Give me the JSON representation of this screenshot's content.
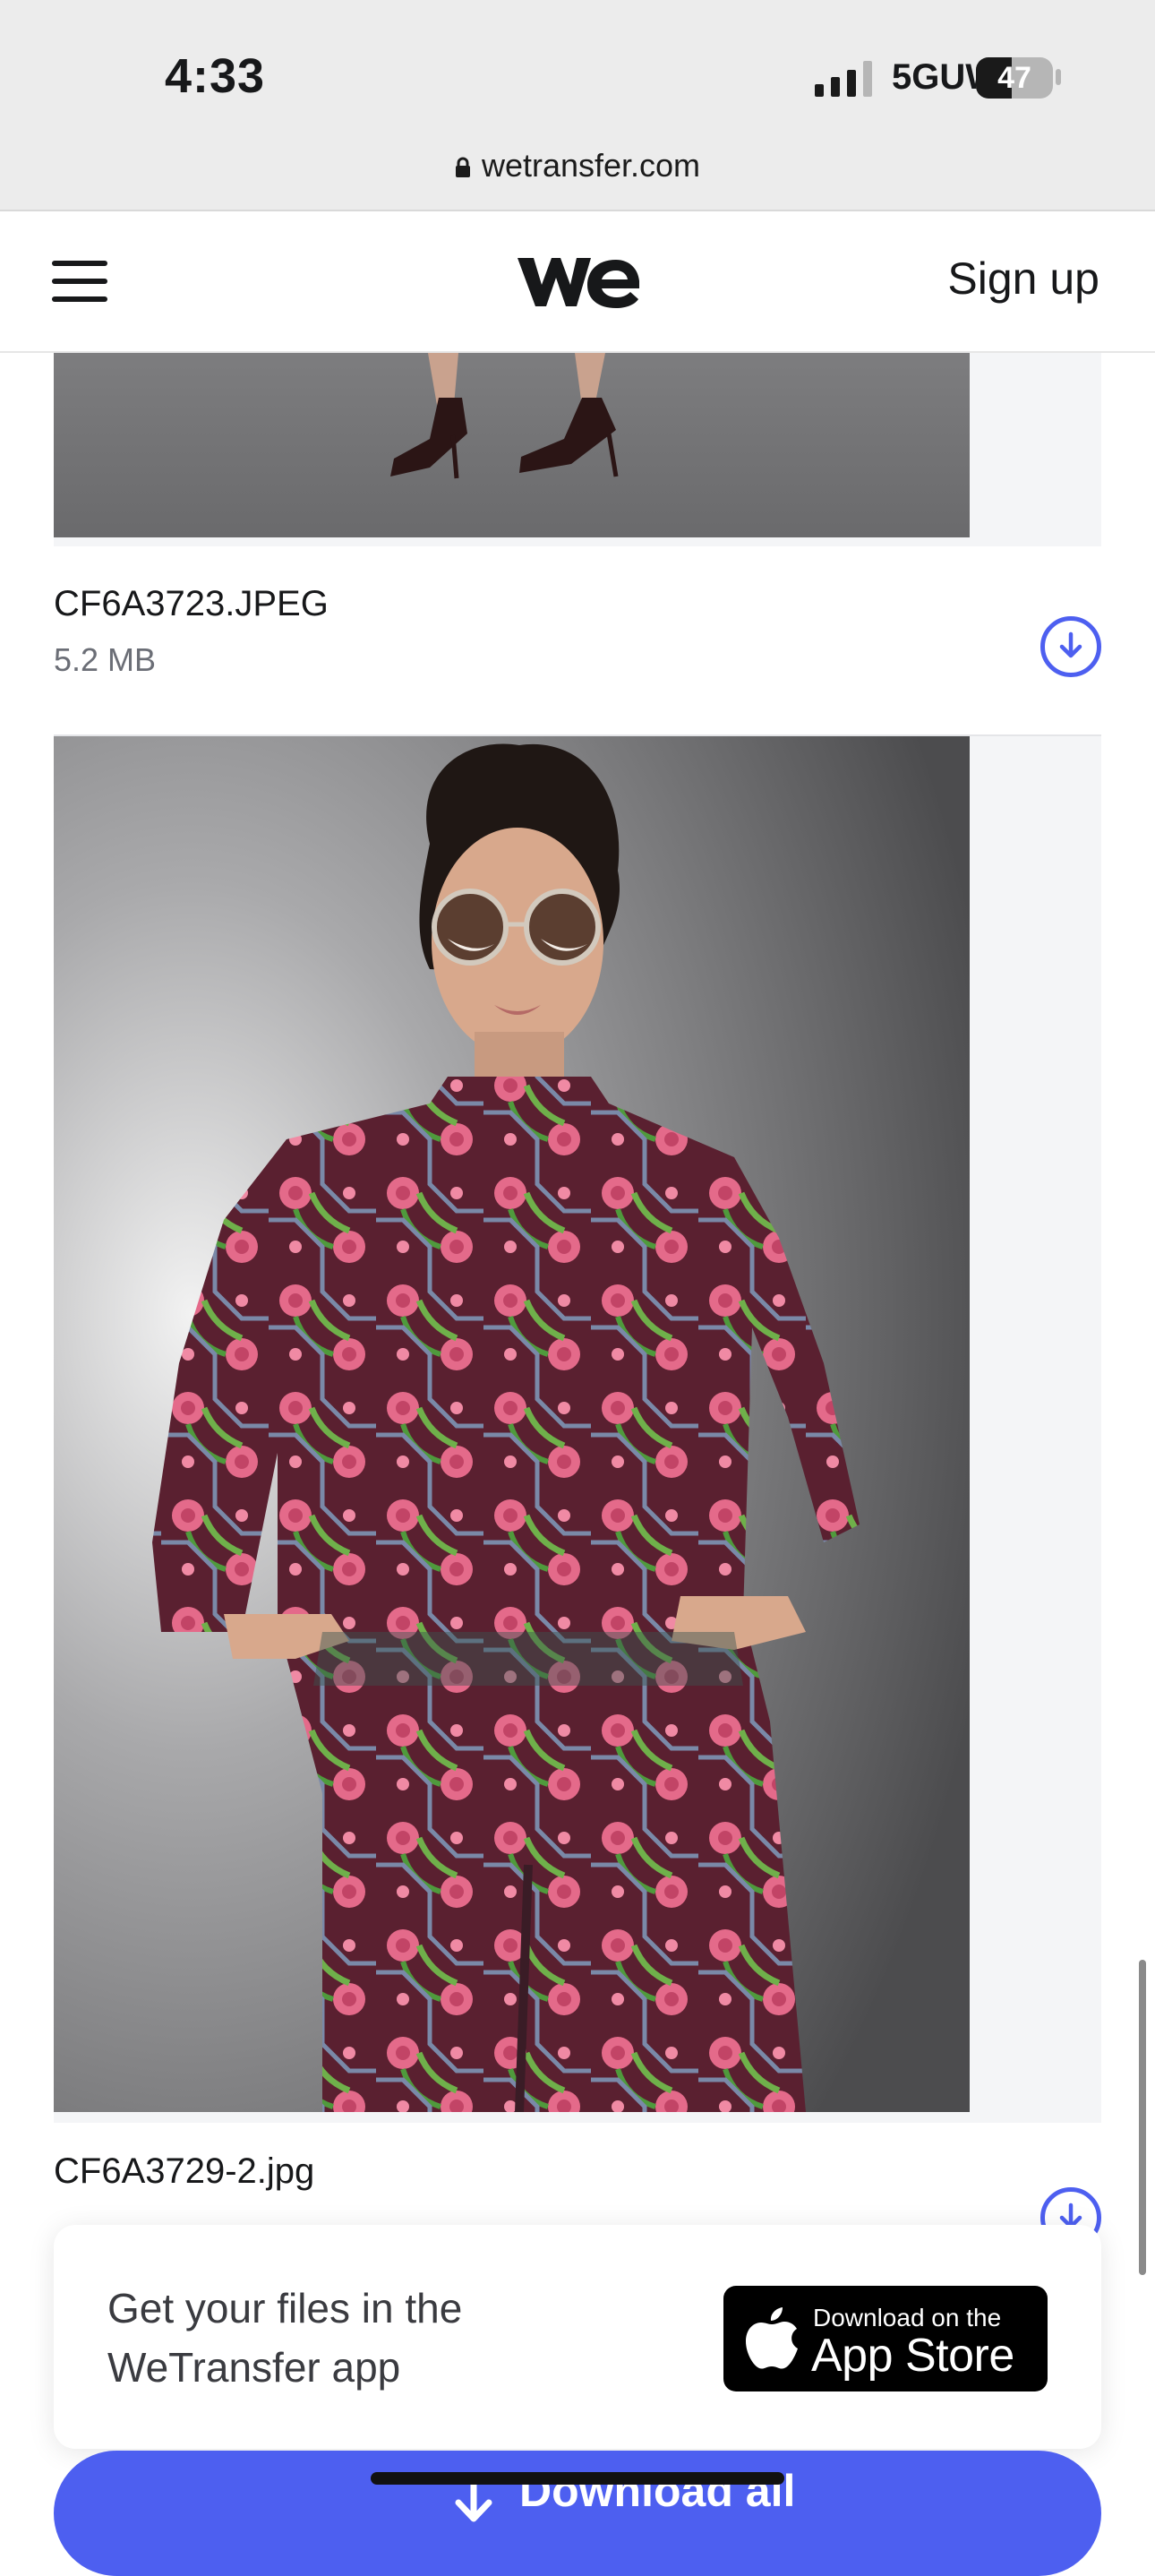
{
  "status_bar": {
    "time": "4:33",
    "network": "5GUW",
    "battery_level": "47",
    "battery_fraction": 0.47
  },
  "browser": {
    "url": "wetransfer.com",
    "lock_icon": "lock-icon"
  },
  "header": {
    "menu_icon": "hamburger-menu-icon",
    "logo_icon": "wetransfer-logo-icon",
    "signup_label": "Sign up"
  },
  "files": [
    {
      "name": "CF6A3723.JPEG",
      "size": "5.2 MB",
      "download_icon": "download-circle-icon"
    },
    {
      "name": "CF6A3729-2.jpg",
      "size": "",
      "download_icon": "download-circle-icon"
    }
  ],
  "app_banner": {
    "text": "Get your files in the WeTransfer app",
    "store_small": "Download on the",
    "store_big": "App Store",
    "apple_icon": "apple-icon"
  },
  "download_all": {
    "label": "Download all",
    "icon": "download-arrow-icon"
  },
  "colors": {
    "accent": "#4d5ff0",
    "text": "#17181a",
    "muted": "#6b6e76",
    "preview_bg": "#f4f5f7"
  }
}
